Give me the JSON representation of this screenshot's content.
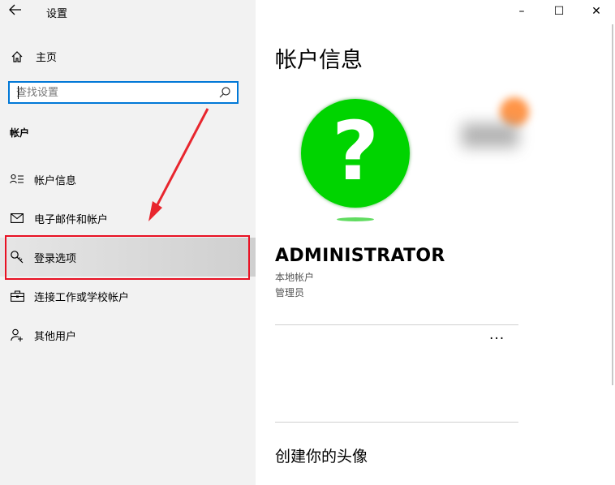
{
  "titlebar": {
    "title": "设置",
    "back_icon": "back-arrow-icon"
  },
  "window_controls": {
    "minimize": "–",
    "maximize": "☐",
    "close": "✕"
  },
  "sidebar": {
    "home_label": "主页",
    "search_placeholder": "查找设置",
    "section_heading": "帐户",
    "items": [
      {
        "label": "帐户信息",
        "icon": "person-list-icon"
      },
      {
        "label": "电子邮件和帐户",
        "icon": "mail-icon"
      },
      {
        "label": "登录选项",
        "icon": "key-icon",
        "active": true
      },
      {
        "label": "连接工作或学校帐户",
        "icon": "briefcase-icon"
      },
      {
        "label": "其他用户",
        "icon": "person-add-icon"
      }
    ]
  },
  "main": {
    "page_title": "帐户信息",
    "avatar_glyph": "?",
    "user_name": "ADMINISTRATOR",
    "user_type": "本地帐户",
    "user_role": "管理员",
    "more_label": "···",
    "create_avatar_heading": "创建你的头像"
  },
  "colors": {
    "accent": "#0078d7",
    "highlight": "#e81123",
    "avatar": "#00d400",
    "sidebar_bg": "#f2f2f2"
  }
}
